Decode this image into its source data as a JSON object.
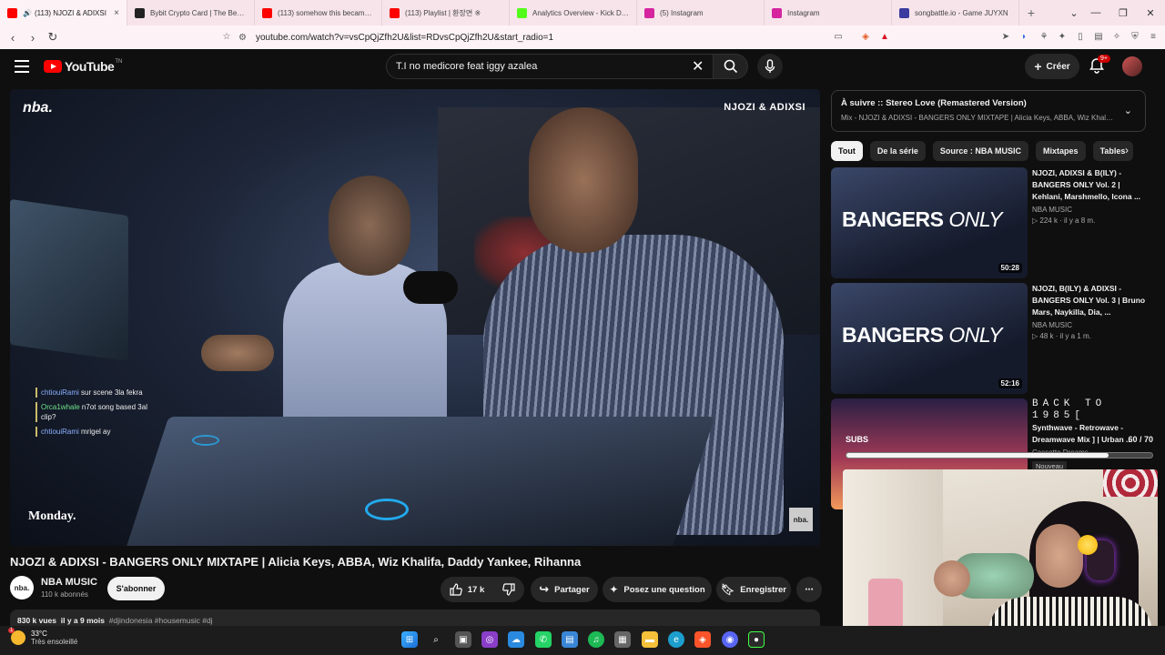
{
  "browser": {
    "tabs": [
      {
        "title": "(113) NJOZI & ADIXSI",
        "active": true,
        "favicon_color": "#ff0000"
      },
      {
        "title": "Bybit Crypto Card | The Best C",
        "favicon_color": "#222222"
      },
      {
        "title": "(113) somehow this became y",
        "favicon_color": "#ff0000"
      },
      {
        "title": "(113) Playlist | 환장면 ※",
        "favicon_color": "#ff0000"
      },
      {
        "title": "Analytics Overview - Kick Das",
        "favicon_color": "#53fc18"
      },
      {
        "title": "(5) Instagram",
        "favicon_color": "#d6249f"
      },
      {
        "title": "Instagram",
        "favicon_color": "#d6249f"
      },
      {
        "title": "songbattle.io - Game JUYXN",
        "favicon_color": "#3b3ba0"
      }
    ],
    "url": "youtube.com/watch?v=vsCpQjZfh2U&list=RDvsCpQjZfh2U&start_radio=1"
  },
  "header": {
    "logo_text": "YouTube",
    "logo_sup": "TN",
    "search_value": "T.I no medicore feat iggy azalea",
    "create_label": "Créer",
    "notif_badge": "9+"
  },
  "player": {
    "watermark_left": "nba.",
    "overlay_title": "NJOZI & ADIXSI",
    "bottom_left_logo": "Monday.",
    "bottom_right_logo": "nba.",
    "chat": [
      {
        "user": "chtiouiRami",
        "text": "sur scene 3la fekra"
      },
      {
        "user": "Orca1whale",
        "text": "n7ot song based 3al clip?"
      },
      {
        "user": "chtiouiRami",
        "text": "mrigel ay"
      }
    ]
  },
  "video": {
    "title": "NJOZI & ADIXSI - BANGERS ONLY MIXTAPE | Alicia Keys, ABBA, Wiz Khalifa, Daddy Yankee, Rihanna",
    "channel": "NBA MUSIC",
    "channel_logo": "nba.",
    "subscribers": "110 k abonnés",
    "subscribe_label": "S'abonner",
    "likes": "17 k",
    "share_label": "Partager",
    "ask_label": "Posez une question",
    "save_label": "Enregistrer",
    "views": "830 k vues",
    "date": "il y a 9 mois",
    "tags": "#djindonesia #housemusic #dj"
  },
  "up_next": {
    "heading": "À suivre :: Stereo Love (Remastered Version)",
    "subtitle": "Mix - NJOZI & ADIXSI - BANGERS ONLY MIXTAPE | Alicia Keys, ABBA, Wiz Khalifa, ..."
  },
  "chips": [
    "Tout",
    "De la série",
    "Source : NBA MUSIC",
    "Mixtapes",
    "Tables"
  ],
  "recommendations": [
    {
      "thumb_text_bold": "BANGERS",
      "thumb_text_italic": "ONLY",
      "duration": "50:28",
      "title": "NJOZI, ADIXSI & B(ILY) - BANGERS ONLY Vol. 2 | Kehlani, Marshmello, Icona ...",
      "channel": "NBA MUSIC",
      "meta": "▷ 224 k · il y a 8 m."
    },
    {
      "thumb_text_bold": "BANGERS",
      "thumb_text_italic": "ONLY",
      "duration": "52:16",
      "title": "NJOZI, B(ILY) & ADIXSI - BANGERS ONLY Vol. 3 | Bruno Mars, Naykilla, Dia, ...",
      "channel": "NBA MUSIC",
      "meta": "▷ 48 k · il y a 1 m."
    },
    {
      "headline": "BACK TO 1985[",
      "title": "Synthwave - Retrowave - Dreamwave Mix ] | Urban ...",
      "channel": "Cassette Dreams",
      "badge": "Nouveau"
    }
  ],
  "subs_goal": {
    "label": "SUBS",
    "current": 60,
    "target": 70,
    "text": "60 / 70"
  },
  "taskbar": {
    "temp": "33°C",
    "weather": "Très ensoleillé",
    "weather_badge": "1"
  }
}
